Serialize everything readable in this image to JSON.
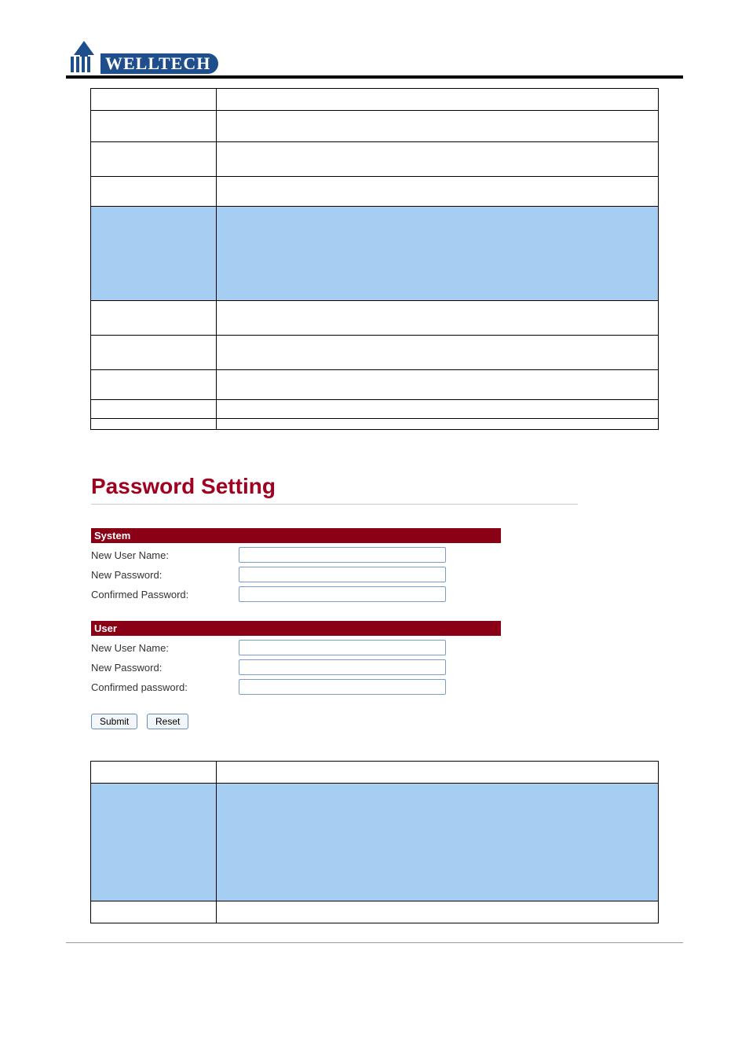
{
  "brand": {
    "name": "WELLTECH"
  },
  "passwordPage": {
    "title": "Password Setting",
    "system": {
      "header": "System",
      "newUserLabel": "New User Name:",
      "newPasswordLabel": "New Password:",
      "confirmLabel": "Confirmed Password:"
    },
    "user": {
      "header": "User",
      "newUserLabel": "New User Name:",
      "newPasswordLabel": "New Password:",
      "confirmLabel": "Confirmed password:"
    },
    "submitLabel": "Submit",
    "resetLabel": "Reset"
  }
}
